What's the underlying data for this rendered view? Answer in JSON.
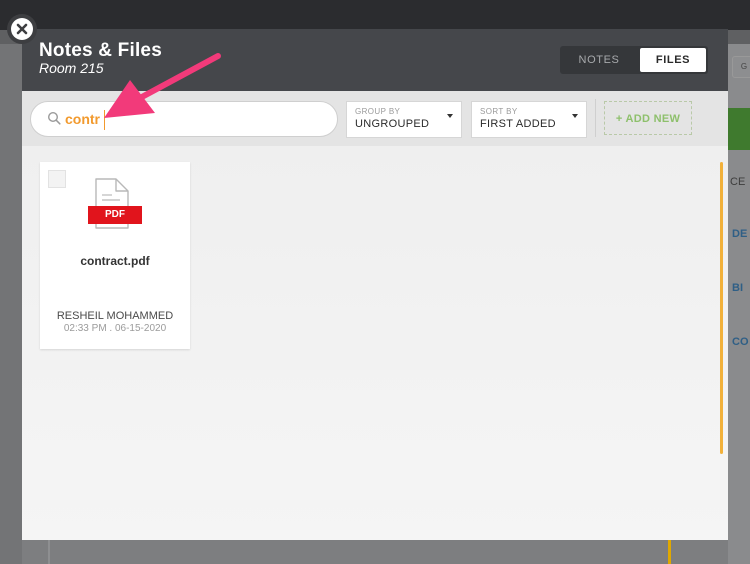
{
  "background": {
    "right_items": [
      "CE",
      "DE",
      "BI",
      "CO"
    ],
    "top_button": "G"
  },
  "modal": {
    "title": "Notes & Files",
    "subtitle": "Room 215",
    "tabs": [
      {
        "label": "NOTES",
        "active": false
      },
      {
        "label": "FILES",
        "active": true
      }
    ]
  },
  "toolbar": {
    "search": {
      "value": "contr",
      "placeholder": ""
    },
    "group_by": {
      "label": "GROUP BY",
      "value": "UNGROUPED"
    },
    "sort_by": {
      "label": "SORT BY",
      "value": "FIRST ADDED"
    },
    "add_new_label": "+ ADD NEW"
  },
  "files": [
    {
      "name": "contract.pdf",
      "type_badge": "PDF",
      "owner": "RESHEIL MOHAMMED",
      "date": "02:33 PM . 06-15-2020"
    }
  ],
  "colors": {
    "accent_orange": "#f29a2e",
    "add_new_green": "#8ec06c",
    "pdf_red": "#e1141c",
    "annotation_arrow": "#f23a7a",
    "header_dark": "#45474b"
  }
}
